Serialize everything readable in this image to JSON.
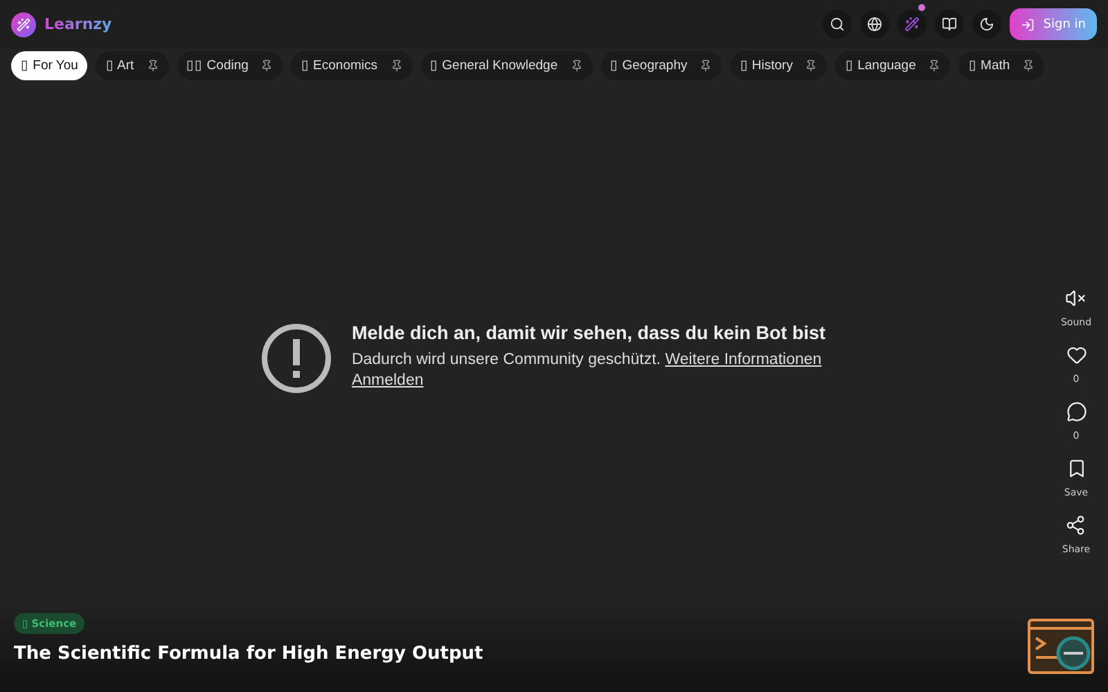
{
  "header": {
    "logo": "Learnzy",
    "sign_in": "Sign in",
    "magic_notification": true
  },
  "categories": [
    {
      "label": "▯ For You",
      "selected": true,
      "pinnable": false
    },
    {
      "label": "▯ Art",
      "selected": false,
      "pinnable": true
    },
    {
      "label": "▯▯ Coding",
      "selected": false,
      "pinnable": true
    },
    {
      "label": "▯ Economics",
      "selected": false,
      "pinnable": true
    },
    {
      "label": "▯ General Knowledge",
      "selected": false,
      "pinnable": true
    },
    {
      "label": "▯ Geography",
      "selected": false,
      "pinnable": true
    },
    {
      "label": "▯ History",
      "selected": false,
      "pinnable": true
    },
    {
      "label": "▯ Language",
      "selected": false,
      "pinnable": true
    },
    {
      "label": "▯ Math",
      "selected": false,
      "pinnable": true
    }
  ],
  "notice": {
    "title": "Melde dich an, damit wir sehen, dass du kein Bot bist",
    "text": "Dadurch wird unsere Community geschützt.",
    "link": "Weitere Informationen",
    "sign_in_link": "Anmelden"
  },
  "actions": [
    {
      "kind": "sound",
      "label": "Sound"
    },
    {
      "kind": "like",
      "label": "0"
    },
    {
      "kind": "comment",
      "label": "0"
    },
    {
      "kind": "save",
      "label": "Save"
    },
    {
      "kind": "share",
      "label": "Share"
    }
  ],
  "video": {
    "tag": "▯ Science",
    "title": "The Scientific Formula for High Energy Output"
  }
}
